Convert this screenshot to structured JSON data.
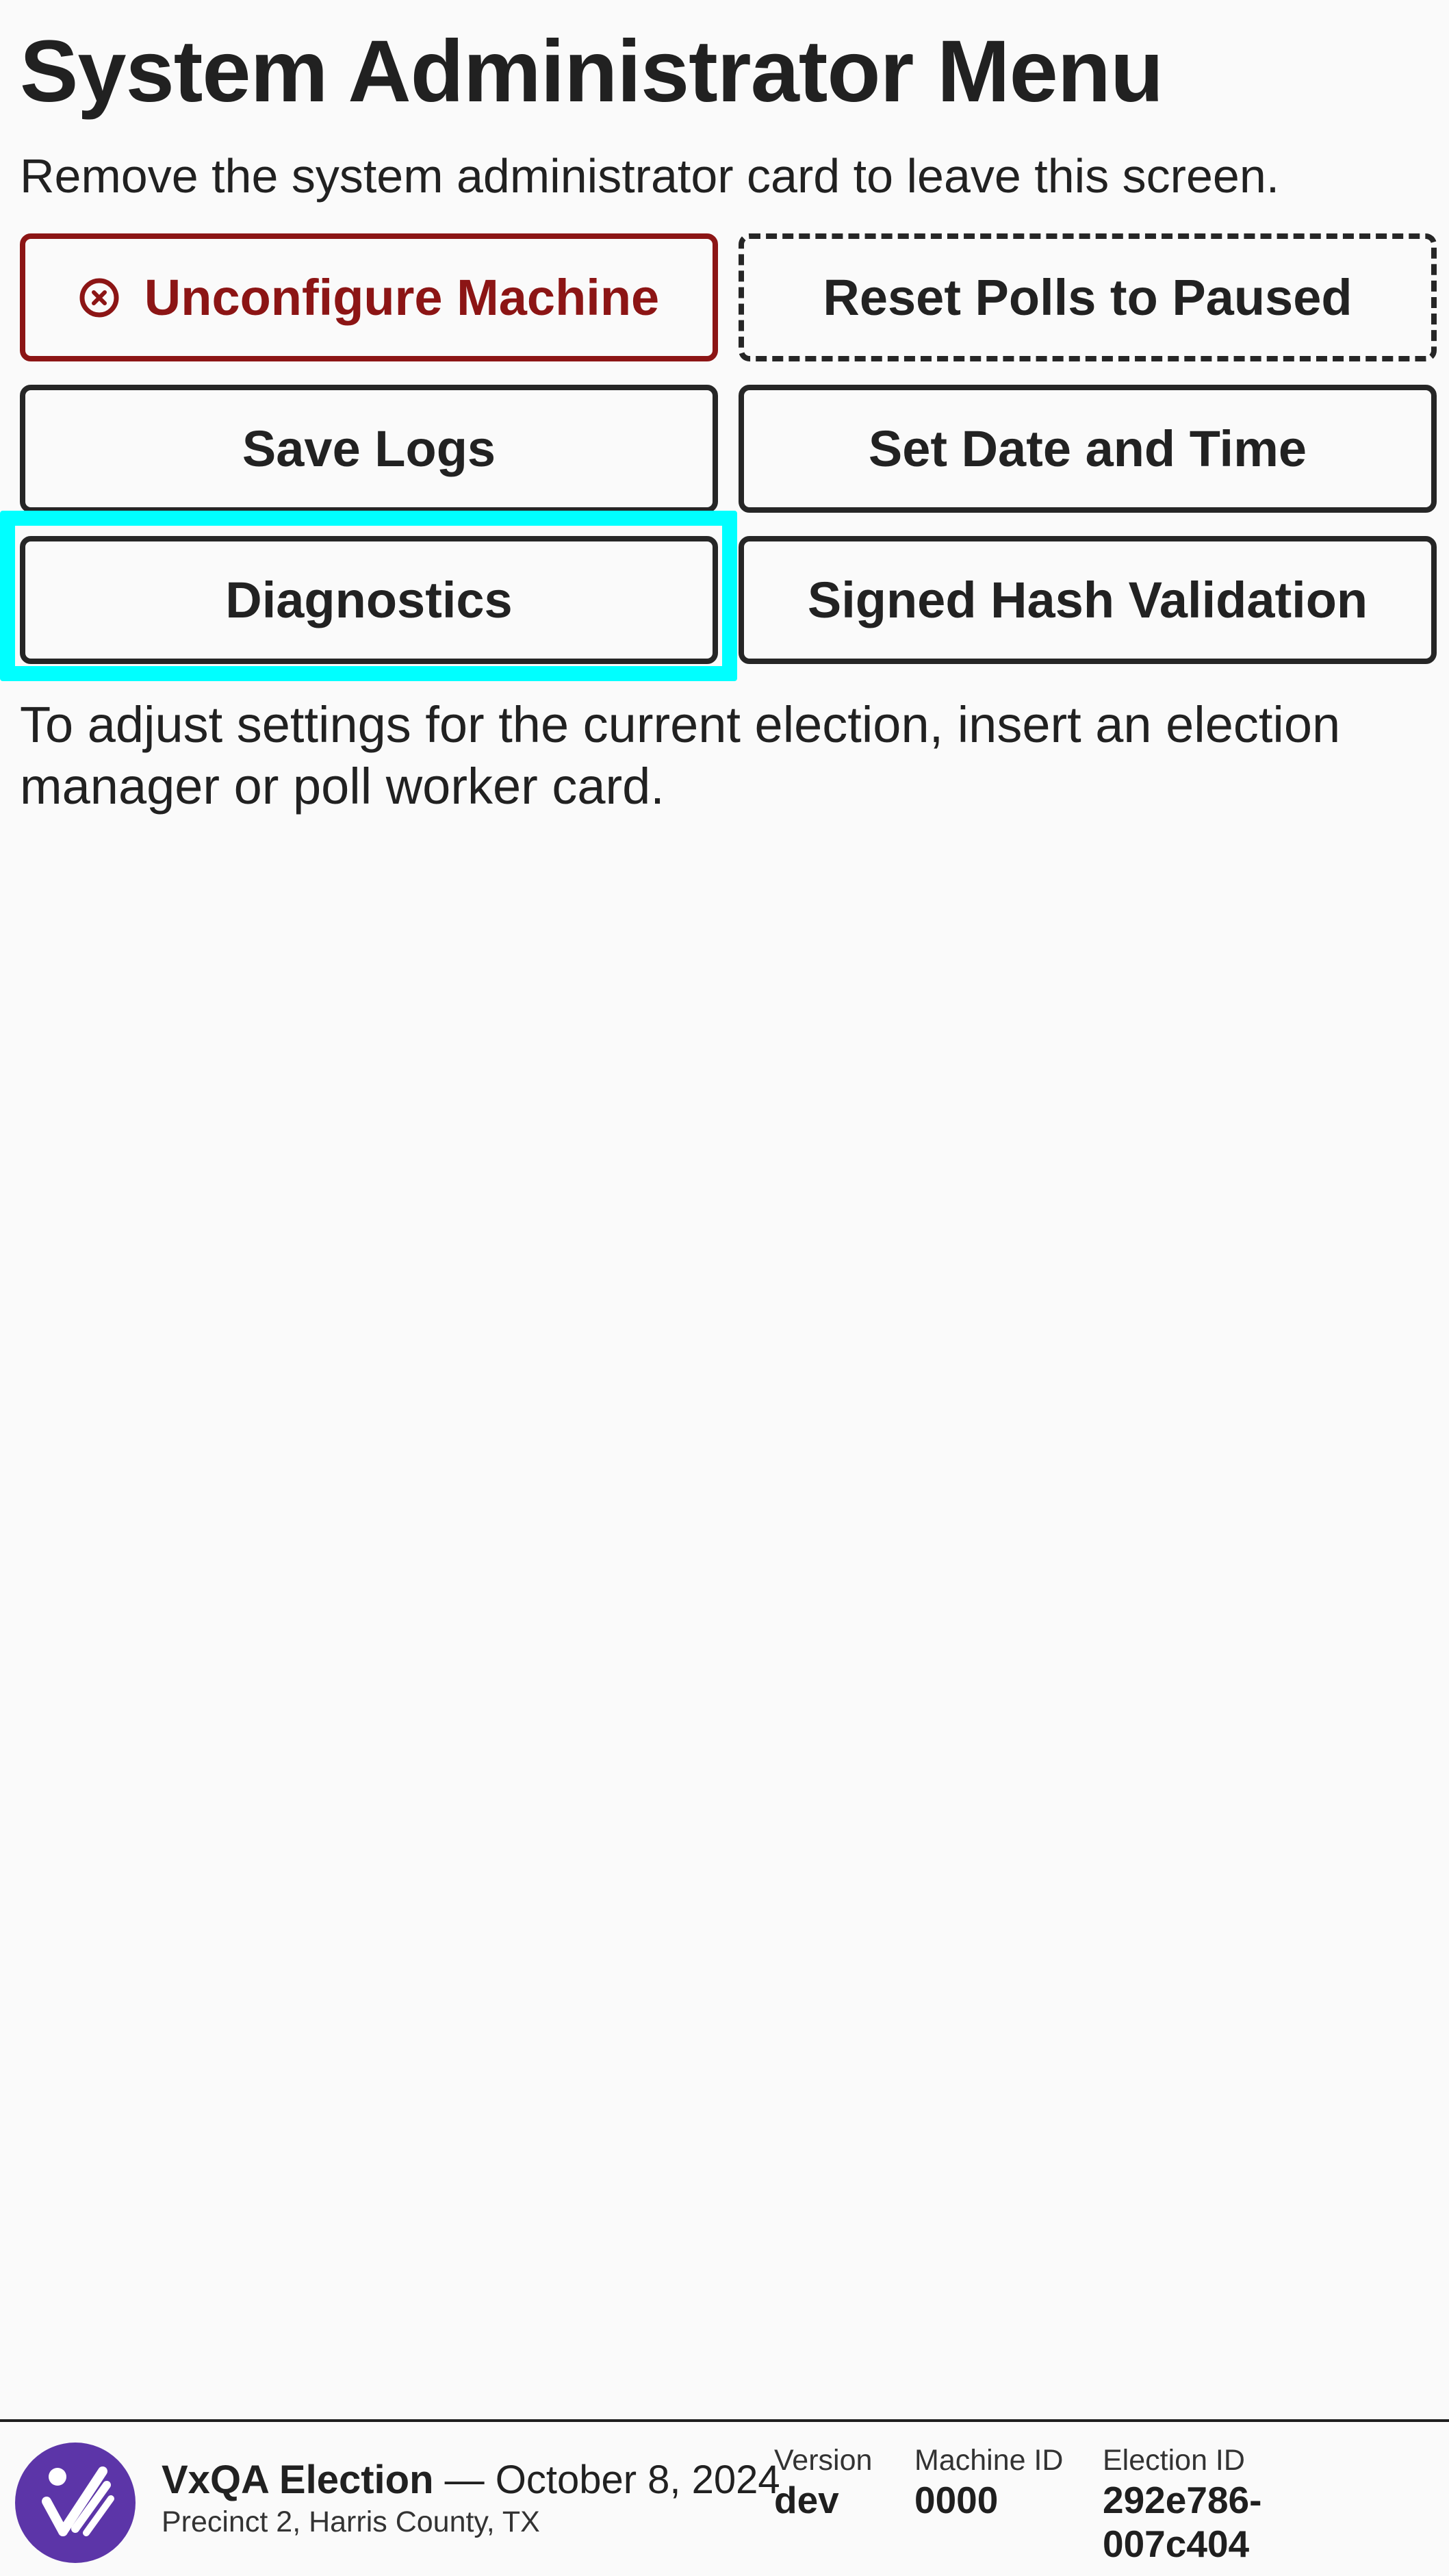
{
  "header": {
    "title": "System Administrator Menu",
    "subtitle": "Remove the system administrator card to leave this screen."
  },
  "buttons": {
    "unconfigure": "Unconfigure Machine",
    "reset_polls": "Reset Polls to Paused",
    "save_logs": "Save Logs",
    "set_date_time": "Set Date and Time",
    "diagnostics": "Diagnostics",
    "signed_hash": "Signed Hash Validation"
  },
  "hint": "To adjust settings for the current election, insert an election manager or poll worker card.",
  "footer": {
    "election_name": "VxQA Election",
    "separator": " — ",
    "election_date": "October 8, 2024",
    "precinct": "Precinct 2, Harris County, TX",
    "version_label": "Version",
    "version_value": "dev",
    "machine_id_label": "Machine ID",
    "machine_id_value": "0000",
    "election_id_label": "Election ID",
    "election_id_line1": "292e786-",
    "election_id_line2": "007c404"
  },
  "colors": {
    "danger": "#8c1515",
    "focus": "#00ffff",
    "logo": "#5c35a8"
  },
  "icons": {
    "unconfigure": "circle-x-icon",
    "logo": "vx-logo-icon"
  }
}
